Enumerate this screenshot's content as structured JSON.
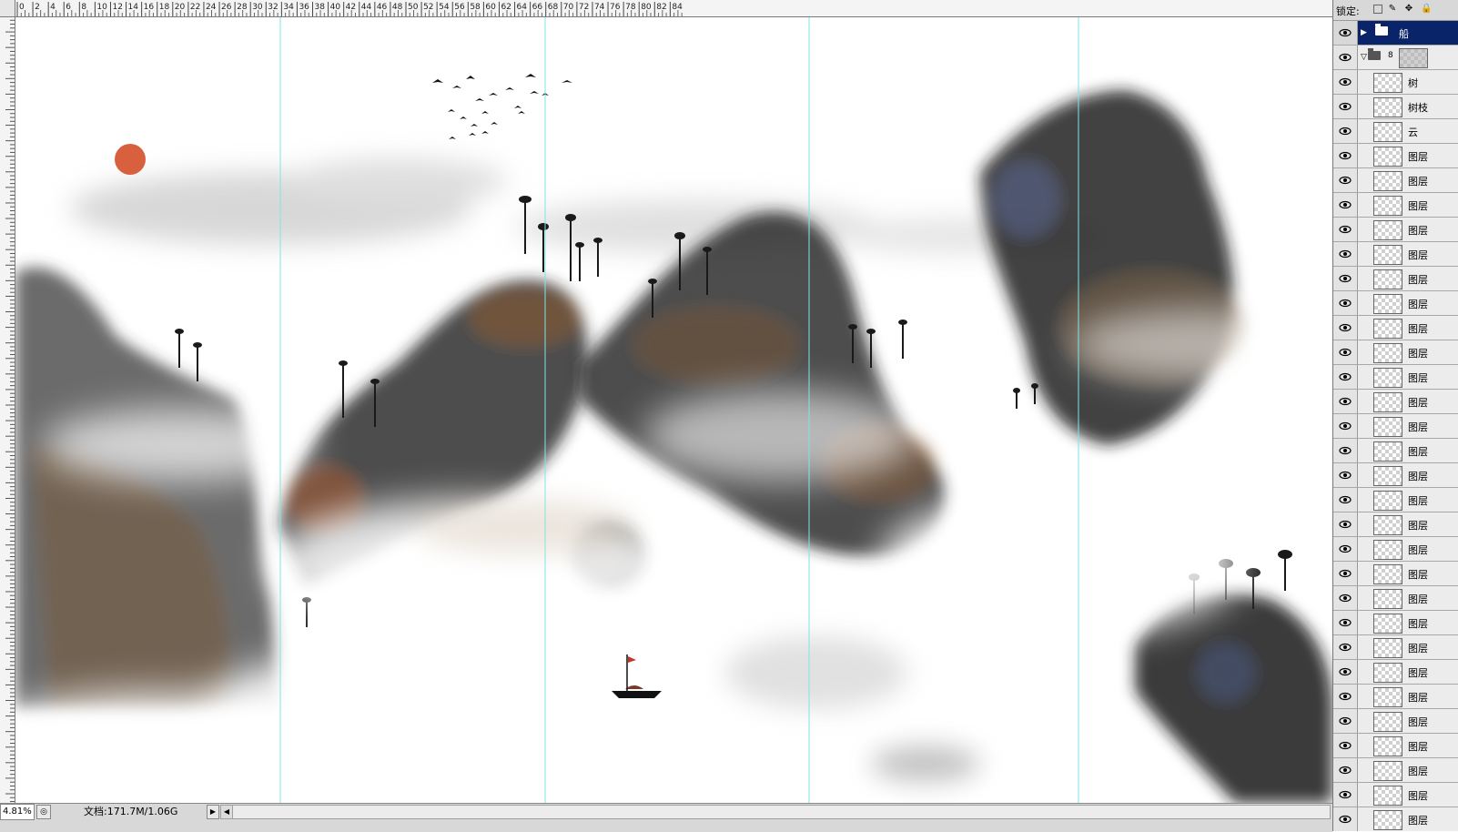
{
  "ruler": {
    "labels": [
      "0",
      "2",
      "4",
      "6",
      "8",
      "10",
      "12",
      "14",
      "16",
      "18",
      "20",
      "22",
      "24",
      "26",
      "28",
      "30",
      "32",
      "34",
      "36",
      "38",
      "40",
      "42",
      "44",
      "46",
      "48",
      "50",
      "52",
      "54",
      "56",
      "58",
      "60",
      "62",
      "64",
      "66",
      "68",
      "70",
      "72",
      "74",
      "76",
      "78",
      "80",
      "82",
      "84"
    ]
  },
  "status": {
    "zoom": "4.81%",
    "doc_info": "文档:171.7M/1.06G"
  },
  "layers_panel": {
    "lock_label": "锁定:",
    "lock_icons": [
      "lock-transparent-icon",
      "lock-brush-icon",
      "lock-move-icon",
      "lock-all-icon"
    ],
    "layers": [
      {
        "name": "船",
        "type": "group-collapsed",
        "selected": true
      },
      {
        "name": "",
        "type": "group-expanded",
        "selected": false
      },
      {
        "name": "树",
        "type": "layer",
        "selected": false
      },
      {
        "name": "树枝",
        "type": "layer",
        "selected": false
      },
      {
        "name": "云",
        "type": "layer",
        "selected": false
      },
      {
        "name": "图层",
        "type": "layer",
        "selected": false
      },
      {
        "name": "图层",
        "type": "layer",
        "selected": false
      },
      {
        "name": "图层",
        "type": "layer",
        "selected": false
      },
      {
        "name": "图层",
        "type": "layer",
        "selected": false
      },
      {
        "name": "图层",
        "type": "layer",
        "selected": false
      },
      {
        "name": "图层",
        "type": "layer",
        "selected": false
      },
      {
        "name": "图层",
        "type": "layer",
        "selected": false
      },
      {
        "name": "图层",
        "type": "layer",
        "selected": false
      },
      {
        "name": "图层",
        "type": "layer",
        "selected": false
      },
      {
        "name": "图层",
        "type": "layer",
        "selected": false
      },
      {
        "name": "图层",
        "type": "layer",
        "selected": false
      },
      {
        "name": "图层",
        "type": "layer",
        "selected": false
      },
      {
        "name": "图层",
        "type": "layer",
        "selected": false
      },
      {
        "name": "图层",
        "type": "layer",
        "selected": false
      },
      {
        "name": "图层",
        "type": "layer",
        "selected": false
      },
      {
        "name": "图层",
        "type": "layer",
        "selected": false
      },
      {
        "name": "图层",
        "type": "layer",
        "selected": false
      },
      {
        "name": "图层",
        "type": "layer",
        "selected": false
      },
      {
        "name": "图层",
        "type": "layer",
        "selected": false
      },
      {
        "name": "图层",
        "type": "layer",
        "selected": false
      },
      {
        "name": "图层",
        "type": "layer",
        "selected": false
      },
      {
        "name": "图层",
        "type": "layer",
        "selected": false
      },
      {
        "name": "图层",
        "type": "layer",
        "selected": false
      },
      {
        "name": "图层",
        "type": "layer",
        "selected": false
      },
      {
        "name": "图层",
        "type": "layer",
        "selected": false
      },
      {
        "name": "图层",
        "type": "layer",
        "selected": false
      },
      {
        "name": "图层",
        "type": "layer",
        "selected": false
      },
      {
        "name": "图层",
        "type": "layer",
        "selected": false
      },
      {
        "name": "图层",
        "type": "layer",
        "selected": false
      }
    ]
  },
  "colors": {
    "guide": "#7fe6e6",
    "selected_layer": "#0a246a",
    "sun": "#d9603f"
  }
}
